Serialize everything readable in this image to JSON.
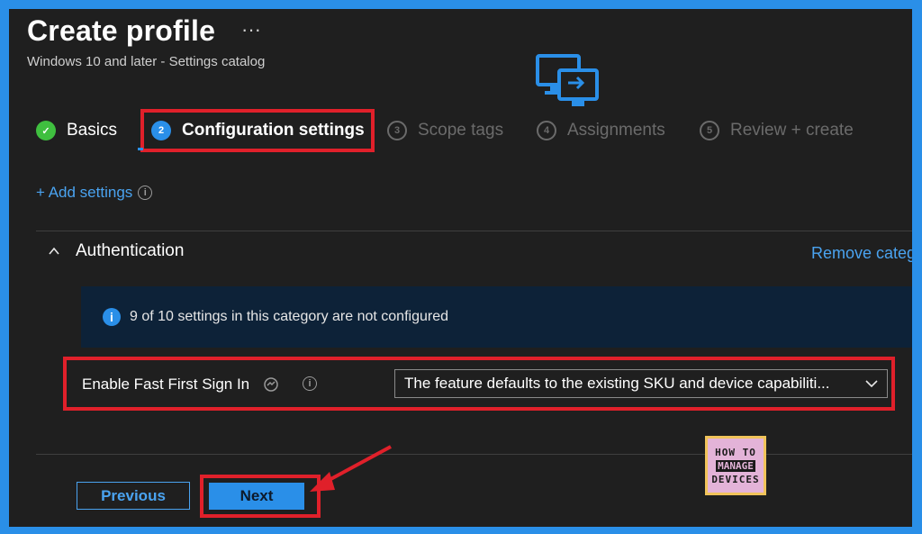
{
  "header": {
    "title": "Create profile",
    "more": "···",
    "subtitle": "Windows 10 and later - Settings catalog"
  },
  "steps": [
    {
      "number": "✓",
      "label": "Basics",
      "state": "complete"
    },
    {
      "number": "2",
      "label": "Configuration settings",
      "state": "current"
    },
    {
      "number": "3",
      "label": "Scope tags",
      "state": "pending"
    },
    {
      "number": "4",
      "label": "Assignments",
      "state": "pending"
    },
    {
      "number": "5",
      "label": "Review + create",
      "state": "pending"
    }
  ],
  "add_settings": {
    "label": "+ Add settings",
    "info": "i"
  },
  "category": {
    "name": "Authentication",
    "remove_label": "Remove category",
    "notice": "9 of 10 settings in this category are not configured"
  },
  "setting": {
    "label": "Enable Fast First Sign In",
    "value": "The feature defaults to the existing SKU and device capabiliti..."
  },
  "footer": {
    "previous_label": "Previous",
    "next_label": "Next"
  },
  "watermark": {
    "line1": "HOW TO",
    "line2": "MANAGE",
    "line3": "DEVICES"
  },
  "colors": {
    "accent": "#2a8fe8",
    "highlight": "#e0202a",
    "success": "#3fbf3f",
    "background": "#1f1f1f"
  },
  "icons": [
    "ellipsis-icon",
    "remote-desktop-icon",
    "check-icon",
    "chevron-up-icon",
    "info-icon",
    "sync-icon",
    "chevron-down-icon",
    "arrow-annotation-icon"
  ]
}
